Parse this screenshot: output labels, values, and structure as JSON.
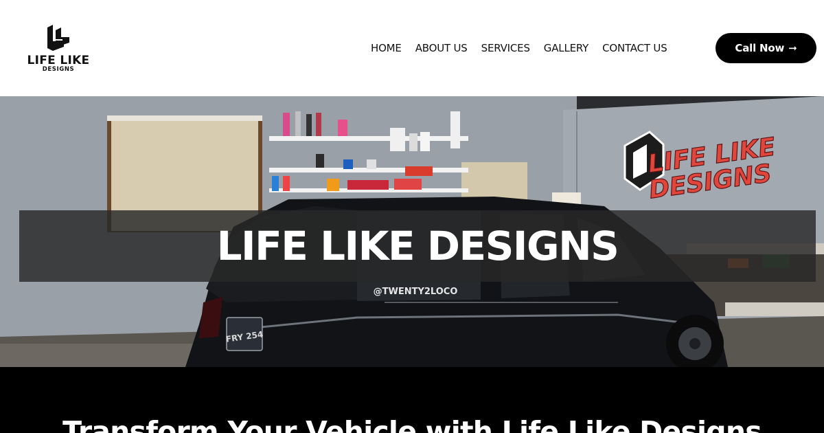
{
  "brand": {
    "name_line1": "LIFE LIKE",
    "name_line2": "DESIGNS",
    "logo_icon": "ll-monogram-icon"
  },
  "nav": {
    "items": [
      {
        "label": "HOME"
      },
      {
        "label": "ABOUT US"
      },
      {
        "label": "SERVICES"
      },
      {
        "label": "GALLERY"
      },
      {
        "label": "CONTACT US"
      }
    ]
  },
  "cta": {
    "label": "Call Now",
    "icon": "arrow-right-icon"
  },
  "hero": {
    "title": "LIFE LIKE DESIGNS",
    "wall_sign_line1": "LIFE LIKE",
    "wall_sign_line2": "DESIGNS",
    "window_sticker": "@TWENTY2LOCO",
    "plate_text": "FRY 254"
  },
  "intro": {
    "heading": "Transform Your Vehicle with Life Like Designs"
  },
  "colors": {
    "accent": "#000000",
    "background": "#ffffff",
    "hero_band": "#282828",
    "sign_red": "#e0463c"
  }
}
